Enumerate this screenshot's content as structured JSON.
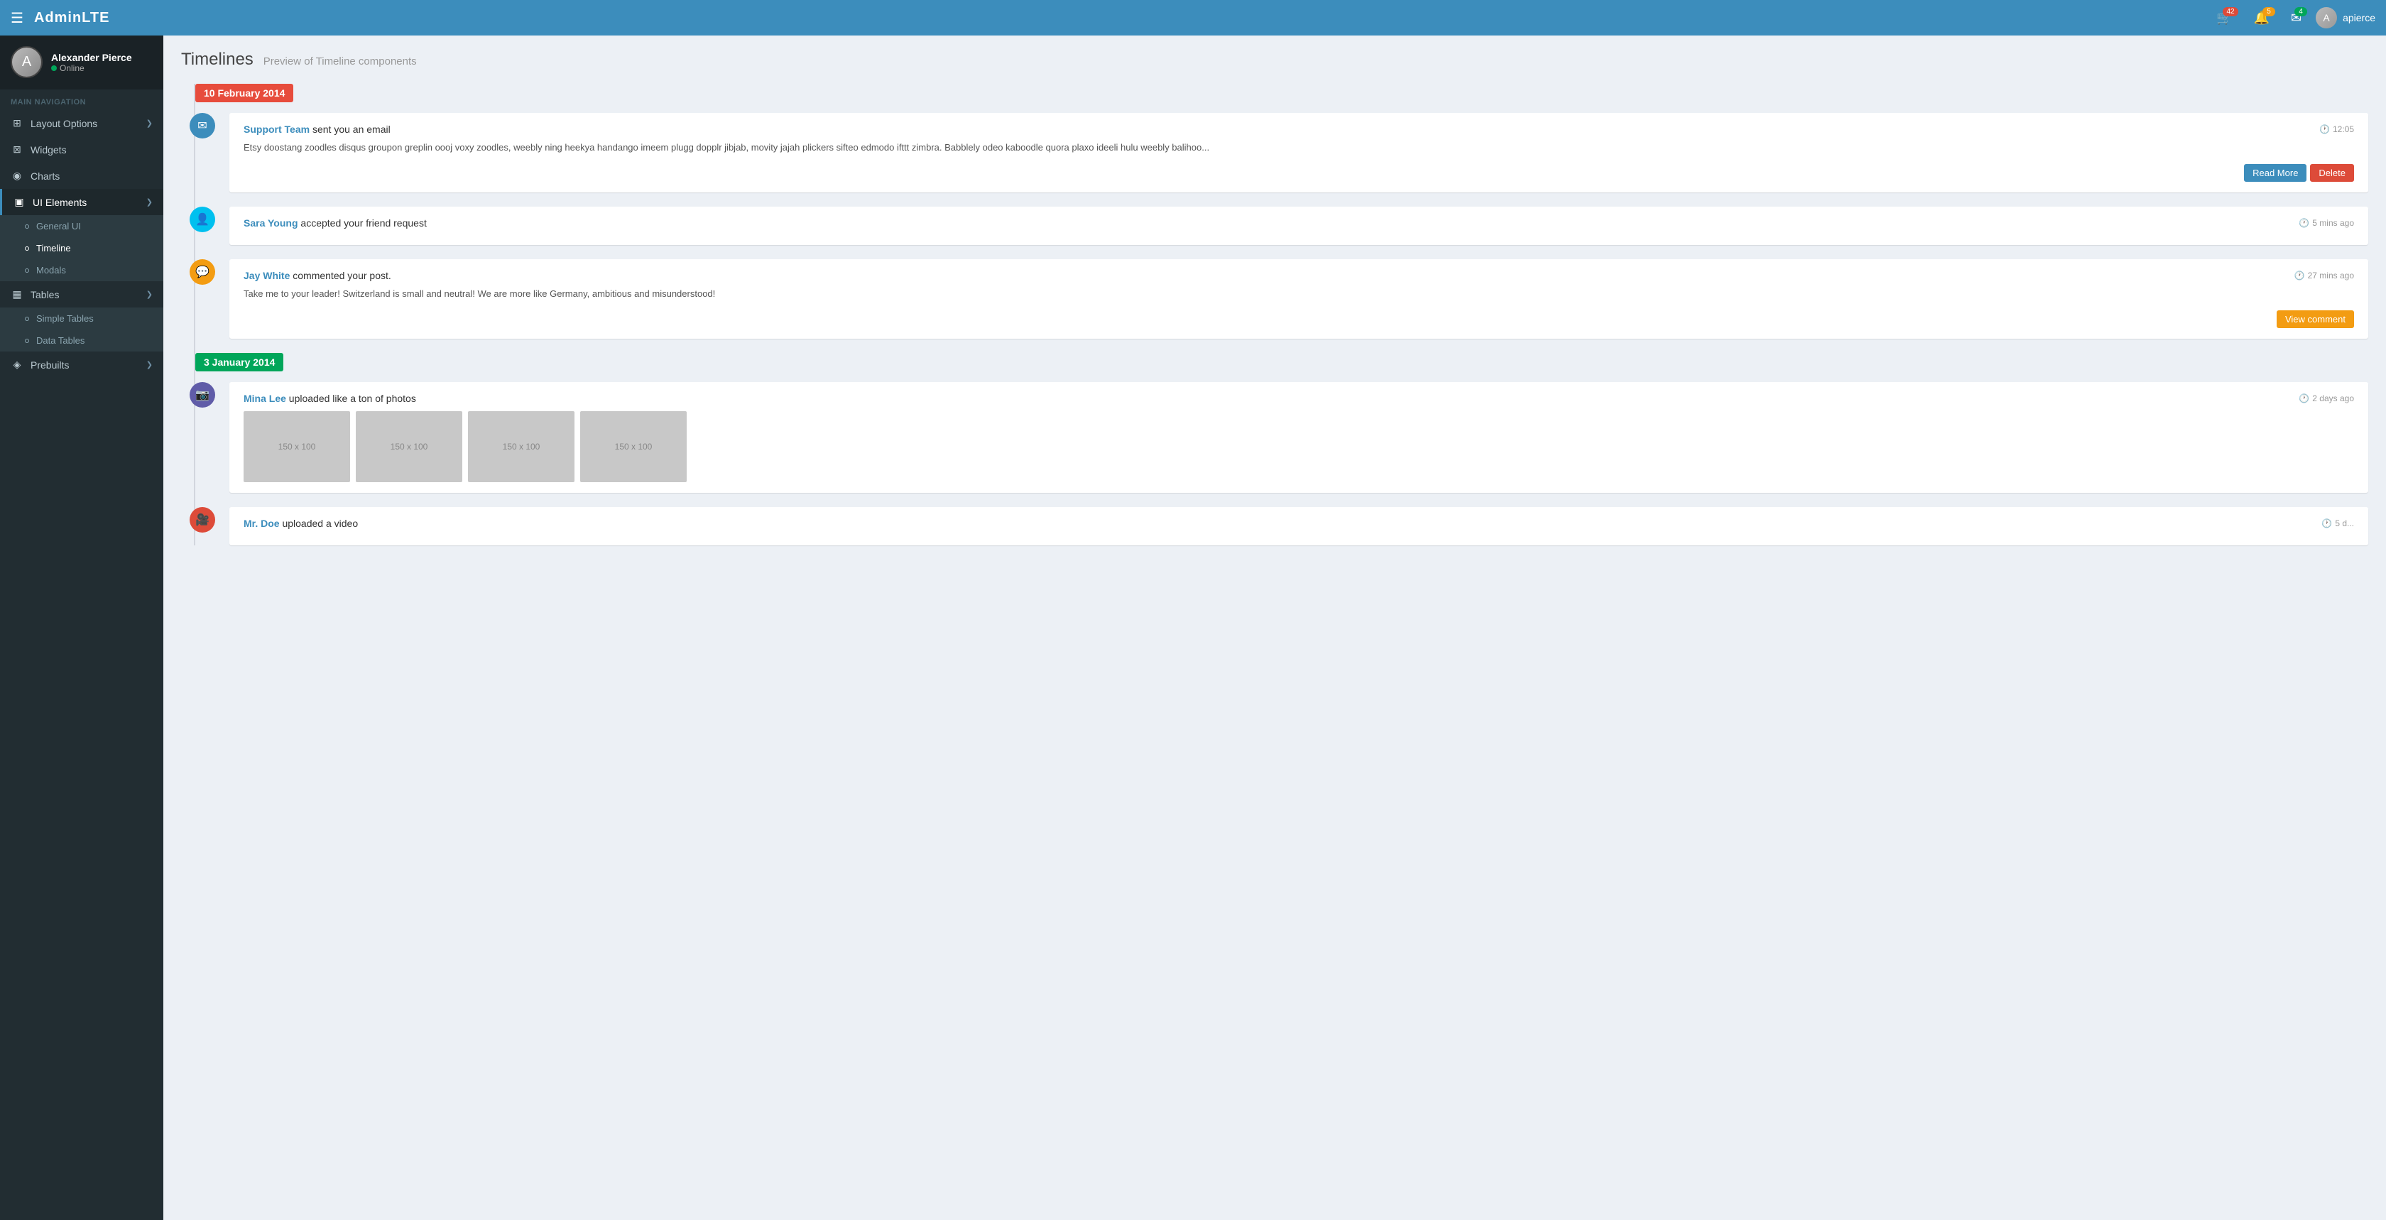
{
  "brand": {
    "name_regular": "Admin",
    "name_bold": "LTE"
  },
  "navbar": {
    "toggle_icon": "☰",
    "badges": [
      {
        "icon": "🛒",
        "count": "42",
        "badge_class": "badge"
      },
      {
        "icon": "🔔",
        "count": "5",
        "badge_class": "badge badge-yellow"
      },
      {
        "icon": "✉",
        "count": "4",
        "badge_class": "badge badge-green"
      }
    ],
    "user": {
      "name": "apierce",
      "avatar_text": "A"
    }
  },
  "sidebar": {
    "user": {
      "name": "Alexander Pierce",
      "status": "Online",
      "avatar_text": "A"
    },
    "section_label": "Main Navigation",
    "items": [
      {
        "id": "layout-options",
        "icon": "⊞",
        "label": "Layout Options",
        "has_arrow": true,
        "active": false
      },
      {
        "id": "widgets",
        "icon": "⊠",
        "label": "Widgets",
        "has_arrow": false,
        "active": false
      },
      {
        "id": "charts",
        "icon": "◉",
        "label": "Charts",
        "has_arrow": false,
        "active": false
      },
      {
        "id": "ui-elements",
        "icon": "▣",
        "label": "UI Elements",
        "has_arrow": true,
        "active": true,
        "sub": [
          {
            "id": "general-ui",
            "label": "General UI",
            "active": false
          },
          {
            "id": "timeline",
            "label": "Timeline",
            "active": true
          },
          {
            "id": "modals",
            "label": "Modals",
            "active": false
          }
        ]
      },
      {
        "id": "tables",
        "icon": "▦",
        "label": "Tables",
        "has_arrow": true,
        "active": false,
        "sub": [
          {
            "id": "simple-tables",
            "label": "Simple Tables",
            "active": false
          },
          {
            "id": "data-tables",
            "label": "Data Tables",
            "active": false
          }
        ]
      },
      {
        "id": "prebuilts",
        "icon": "◈",
        "label": "Prebuilts",
        "has_arrow": true,
        "active": false
      }
    ]
  },
  "page": {
    "title": "Timelines",
    "subtitle": "Preview of Timeline components"
  },
  "timeline": {
    "sections": [
      {
        "date": "10 February 2014",
        "date_class": "red",
        "items": [
          {
            "id": "item-email",
            "icon": "✉",
            "icon_class": "blue",
            "title_link": "Support Team",
            "title_rest": " sent you an email",
            "time": "12:05",
            "body": "Etsy doostang zoodles disqus groupon greplin oooj voxy zoodles, weebly ning heekya handango imeem plugg dopplr jibjab, movity jajah plickers sifteo edmodo ifttt zimbra. Babblely odeo kaboodle quora plaxo ideeli hulu weebly balihoo...",
            "buttons": [
              {
                "label": "Read More",
                "class": "btn-primary"
              },
              {
                "label": "Delete",
                "class": "btn-danger"
              }
            ]
          },
          {
            "id": "item-friend",
            "icon": "👤",
            "icon_class": "teal",
            "title_link": "Sara Young",
            "title_rest": " accepted your friend request",
            "time": "5 mins ago",
            "body": "",
            "buttons": []
          },
          {
            "id": "item-comment",
            "icon": "💬",
            "icon_class": "yellow",
            "title_link": "Jay White",
            "title_rest": " commented your post.",
            "time": "27 mins ago",
            "body": "Take me to your leader! Switzerland is small and neutral! We are more like Germany, ambitious and misunderstood!",
            "buttons": [
              {
                "label": "View comment",
                "class": "btn-warning"
              }
            ]
          }
        ]
      },
      {
        "date": "3 January 2014",
        "date_class": "green",
        "items": [
          {
            "id": "item-photos",
            "icon": "📷",
            "icon_class": "purple",
            "title_link": "Mina Lee",
            "title_rest": " uploaded like a ton of photos",
            "time": "2 days ago",
            "body": "",
            "photos": [
              "150 x 100",
              "150 x 100",
              "150 x 100",
              "150 x 100"
            ],
            "buttons": []
          },
          {
            "id": "item-video",
            "icon": "🎥",
            "icon_class": "red",
            "title_link": "Mr. Doe",
            "title_rest": " uploaded a video",
            "time": "5 d...",
            "body": "",
            "buttons": []
          }
        ]
      }
    ]
  }
}
